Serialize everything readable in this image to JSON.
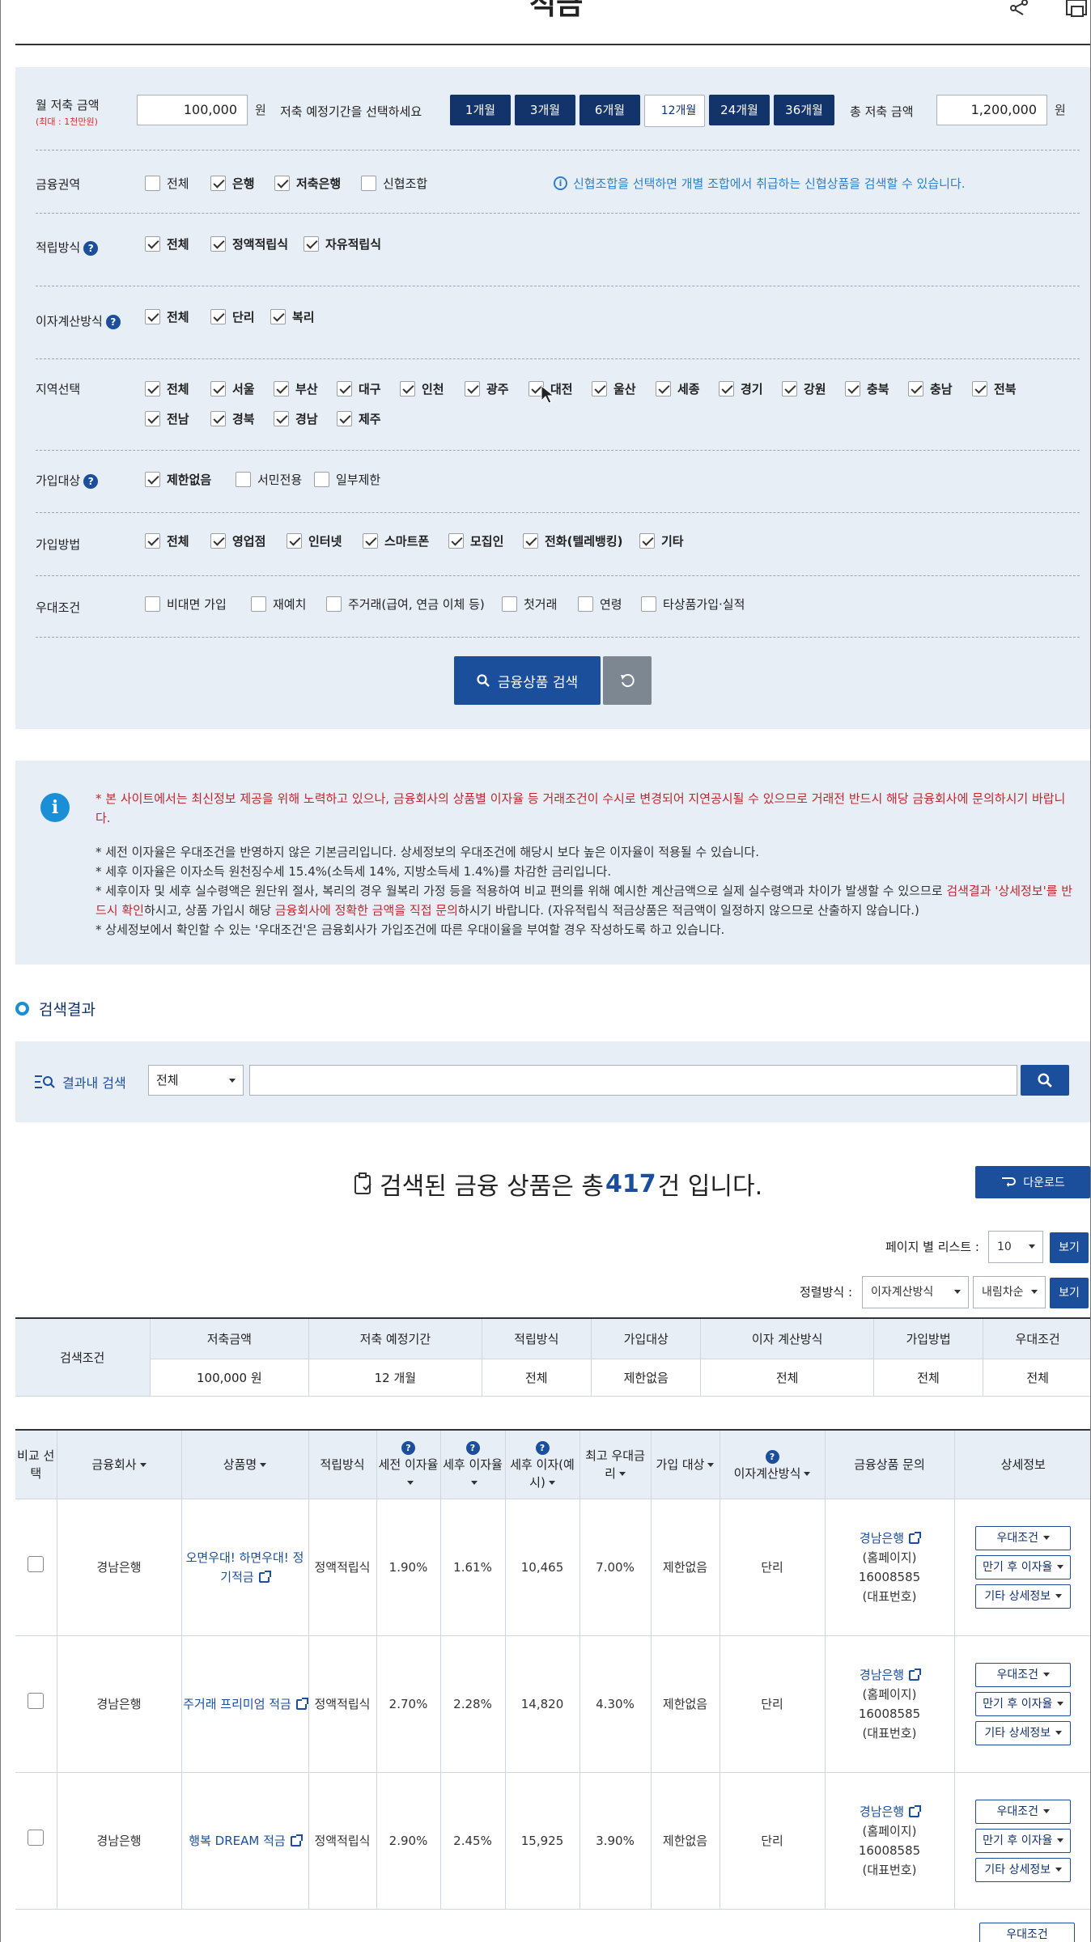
{
  "header": {
    "title": "적금"
  },
  "amount": {
    "label": "월 저축 금액",
    "sub": "(최대 : 1천만원)",
    "value": "100,000",
    "unit": "원"
  },
  "period": {
    "label": "저축 예정기간을 선택하세요",
    "options": [
      "1개월",
      "3개월",
      "6개월",
      "12개월",
      "24개월",
      "36개월"
    ],
    "selected": "12개월"
  },
  "total": {
    "label": "총 저축 금액",
    "value": "1,200,000",
    "unit": "원"
  },
  "filters": {
    "institution": {
      "label": "금융권역",
      "options": [
        {
          "t": "전체",
          "on": false
        },
        {
          "t": "은행",
          "on": true
        },
        {
          "t": "저축은행",
          "on": true
        },
        {
          "t": "신협조합",
          "on": false
        }
      ],
      "note": "신협조합을 선택하면 개별 조합에서 취급하는 신협상품을 검색할 수 있습니다."
    },
    "method": {
      "label": "적립방식",
      "options": [
        {
          "t": "전체",
          "on": true
        },
        {
          "t": "정액적립식",
          "on": true
        },
        {
          "t": "자유적립식",
          "on": true
        }
      ]
    },
    "interest": {
      "label": "이자계산방식",
      "options": [
        {
          "t": "전체",
          "on": true
        },
        {
          "t": "단리",
          "on": true
        },
        {
          "t": "복리",
          "on": true
        }
      ]
    },
    "region": {
      "label": "지역선택",
      "options": [
        "전체",
        "서울",
        "부산",
        "대구",
        "인천",
        "광주",
        "대전",
        "울산",
        "세종",
        "경기",
        "강원",
        "충북",
        "충남",
        "전북",
        "전남",
        "경북",
        "경남",
        "제주"
      ]
    },
    "target": {
      "label": "가입대상",
      "options": [
        {
          "t": "제한없음",
          "on": true
        },
        {
          "t": "서민전용",
          "on": false
        },
        {
          "t": "일부제한",
          "on": false
        }
      ]
    },
    "join": {
      "label": "가입방법",
      "options": [
        {
          "t": "전체",
          "on": true
        },
        {
          "t": "영업점",
          "on": true
        },
        {
          "t": "인터넷",
          "on": true
        },
        {
          "t": "스마트폰",
          "on": true
        },
        {
          "t": "모집인",
          "on": true
        },
        {
          "t": "전화(텔레뱅킹)",
          "on": true
        },
        {
          "t": "기타",
          "on": true
        }
      ]
    },
    "pref": {
      "label": "우대조건",
      "options": [
        {
          "t": "비대면 가입",
          "on": false
        },
        {
          "t": "재예치",
          "on": false
        },
        {
          "t": "주거래(급여, 연금 이체 등)",
          "on": false
        },
        {
          "t": "첫거래",
          "on": false
        },
        {
          "t": "연령",
          "on": false
        },
        {
          "t": "타상품가입·실적",
          "on": false
        }
      ]
    }
  },
  "search_button": "금융상품 검색",
  "notice": {
    "red": "* 본 사이트에서는 최신정보 제공을 위해 노력하고 있으나, 금융회사의 상품별 이자율 등 거래조건이 수시로 변경되어 지연공시될 수 있으므로 거래전 반드시 해당 금융회사에 문의하시기 바랍니다.",
    "l1": "* 세전 이자율은 우대조건을 반영하지 않은 기본금리입니다. 상세정보의 우대조건에 해당시 보다 높은 이자율이 적용될 수 있습니다.",
    "l2": "* 세후 이자율은 이자소득 원천징수세 15.4%(소득세 14%, 지방소득세 1.4%)를 차감한 금리입니다.",
    "l3a": "* 세후이자 및 세후 실수령액은 원단위 절사, 복리의 경우 월복리 가정 등을 적용하여 비교 편의를 위해 예시한 계산금액으로 실제 실수령액과 차이가 발생할 수 있으므로 ",
    "l3b": "검색결과 '상세정보'를 반드시 확인",
    "l3c": "하시고, 상품 가입시 해당 ",
    "l3d": "금융회사에 정확한 금액을 직접 문의",
    "l3e": "하시기 바랍니다. (자유적립식 적금상품은 적금액이 일정하지 않으므로 산출하지 않습니다.)",
    "l4": "* 상세정보에서 확인할 수 있는 '우대조건'은 금융회사가 가입조건에 따른 우대이율을 부여할 경우 작성하도록 하고 있습니다."
  },
  "results": {
    "title": "검색결과",
    "inner_label": "결과내 검색",
    "inner_select": "전체",
    "count_pre": "검색된 금융 상품은 총 ",
    "count": "417",
    "count_post": "건 입니다.",
    "download": "다운로드",
    "per_page_label": "페이지 별 리스트 :",
    "per_page": "10",
    "view": "보기",
    "sort_label": "정렬방식 :",
    "sort1": "이자계산방식",
    "sort2": "내림차순"
  },
  "conditions": {
    "lead": "검색조건",
    "headers": [
      "저축금액",
      "저축 예정기간",
      "적립방식",
      "가입대상",
      "이자 계산방식",
      "가입방법",
      "우대조건"
    ],
    "values": [
      "100,000 원",
      "12 개월",
      "전체",
      "제한없음",
      "전체",
      "전체",
      "전체"
    ]
  },
  "table": {
    "headers": {
      "compare": "비교 선택",
      "company": "금융회사",
      "product": "상품명",
      "method": "적립방식",
      "pre": "세전 이자율",
      "post": "세후 이자율",
      "postint": "세후 이자(예시)",
      "max": "최고 우대금리",
      "target": "가입 대상",
      "calc": "이자계산방식",
      "inquiry": "금융상품 문의",
      "detail": "상세정보"
    },
    "buttons": {
      "pref": "우대조건",
      "mat": "만기 후 이자율",
      "etc": "기타 상세정보"
    },
    "inq": {
      "home": "(홈페이지)",
      "tel": "16008585",
      "telnote": "(대표번호)"
    },
    "rows": [
      {
        "company": "경남은행",
        "product": "오면우대! 하면우대! 정기적금",
        "method": "정액적립식",
        "pre": "1.90%",
        "post": "1.61%",
        "postint": "10,465",
        "max": "7.00%",
        "target": "제한없음",
        "calc": "단리",
        "bank": "경남은행"
      },
      {
        "company": "경남은행",
        "product": "주거래 프리미엄 적금",
        "method": "정액적립식",
        "pre": "2.70%",
        "post": "2.28%",
        "postint": "14,820",
        "max": "4.30%",
        "target": "제한없음",
        "calc": "단리",
        "bank": "경남은행"
      },
      {
        "company": "경남은행",
        "product": "행복 DREAM 적금",
        "method": "정액적립식",
        "pre": "2.90%",
        "post": "2.45%",
        "postint": "15,925",
        "max": "3.90%",
        "target": "제한없음",
        "calc": "단리",
        "bank": "경남은행"
      }
    ]
  }
}
